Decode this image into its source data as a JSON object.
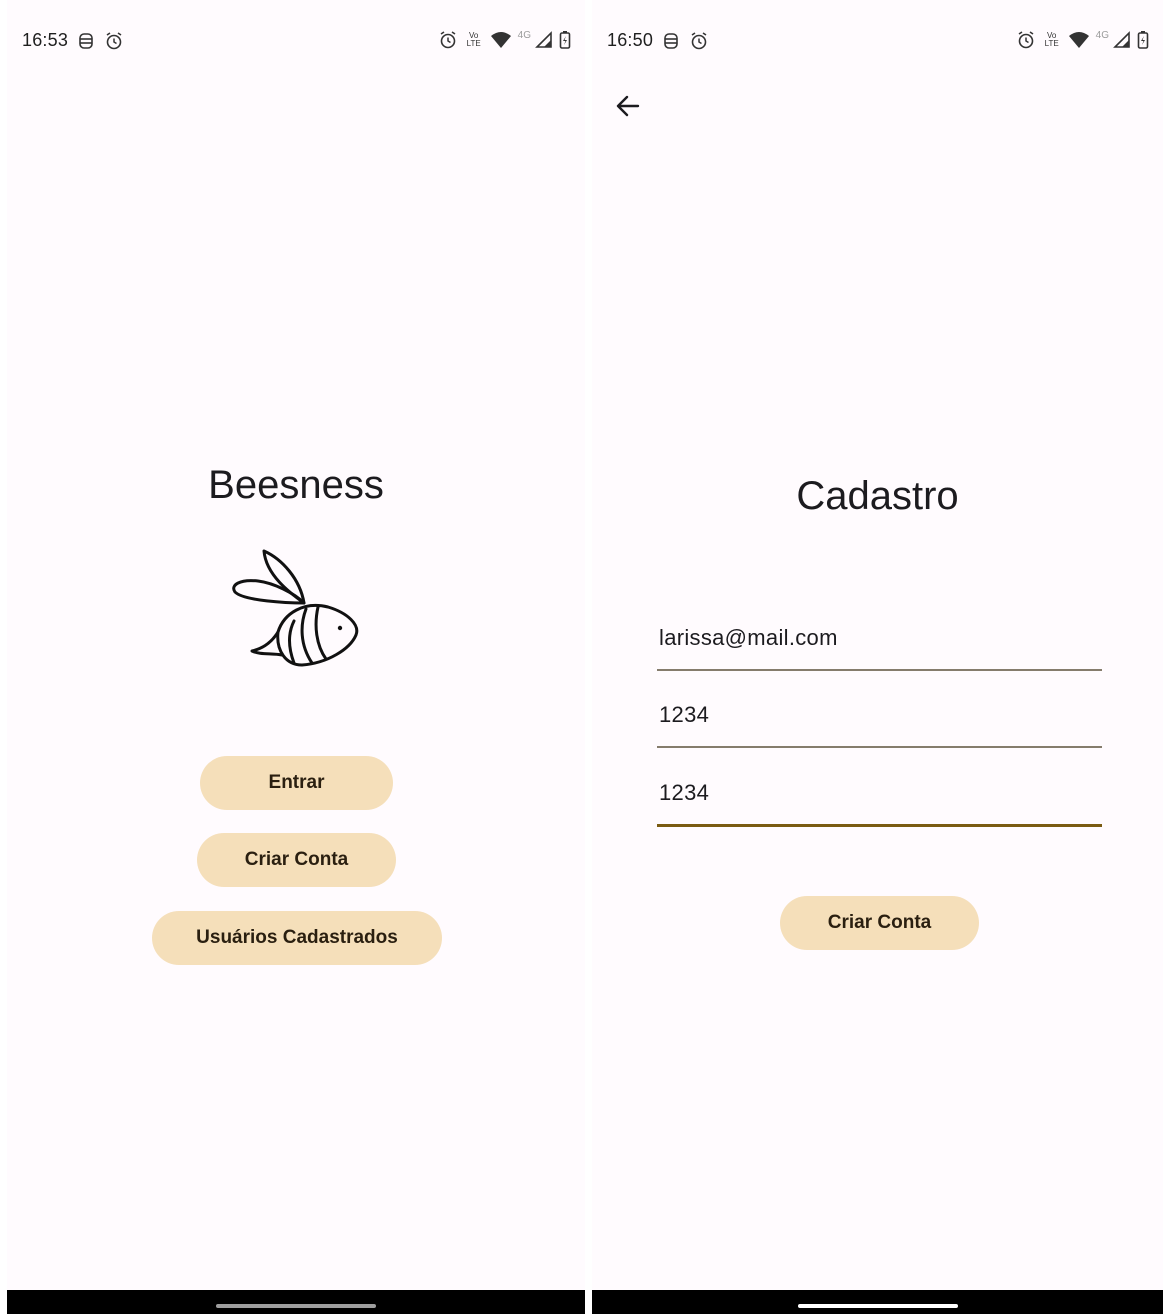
{
  "left_screen": {
    "status": {
      "time": "16:53",
      "lte": "Vo LTE",
      "net": "4G"
    },
    "title": "Beesness",
    "logo_icon": "bee-icon",
    "buttons": {
      "login": "Entrar",
      "create_account": "Criar Conta",
      "registered_users": "Usuários Cadastrados"
    }
  },
  "right_screen": {
    "status": {
      "time": "16:50",
      "lte": "Vo LTE",
      "net": "4G"
    },
    "back_icon": "arrow-back-icon",
    "title": "Cadastro",
    "fields": {
      "email": "larissa@mail.com",
      "password": "1234",
      "confirm_password": "1234"
    },
    "submit": "Criar Conta"
  },
  "colors": {
    "background": "#fffbfe",
    "button": "#f5dfba",
    "field_underline": "#857c6c",
    "field_underline_active": "#7a5b12",
    "nav_handle_left": "#9e9e9e",
    "nav_handle_right": "#ffffff"
  }
}
